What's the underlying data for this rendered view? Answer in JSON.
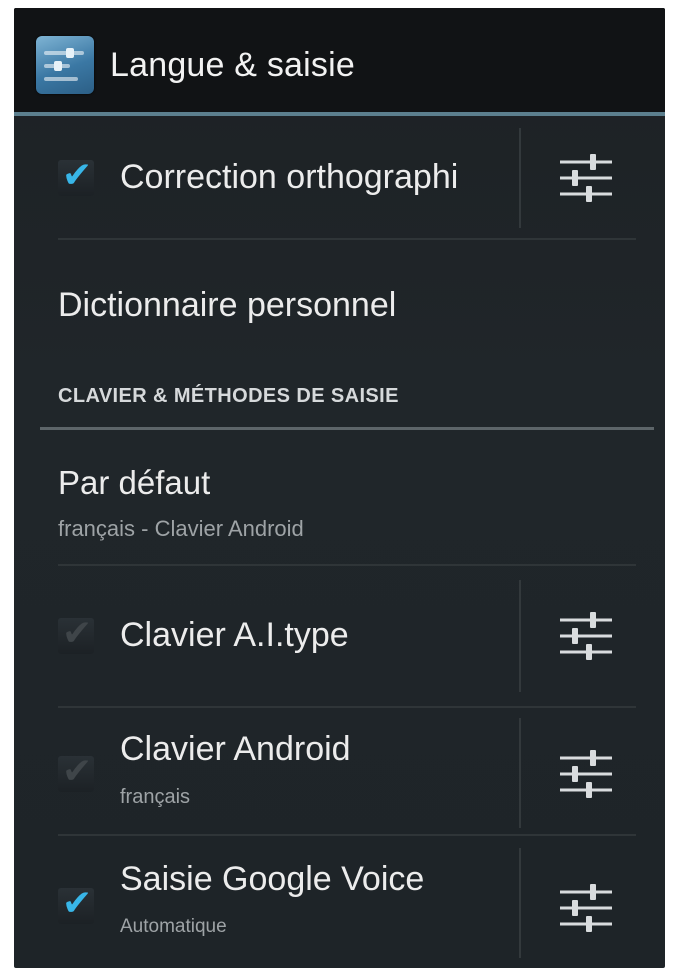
{
  "action_bar": {
    "title": "Langue & saisie",
    "icon": "language-settings-icon"
  },
  "items": [
    {
      "label": "Correction orthographi",
      "checked": true,
      "has_settings": true
    },
    {
      "label": "Dictionnaire personnel"
    },
    {
      "label": "Par défaut",
      "summary": "français - Clavier Android"
    },
    {
      "label": "Clavier A.I.type",
      "checked": false,
      "has_settings": true
    },
    {
      "label": "Clavier Android",
      "summary": "français",
      "checked": false,
      "has_settings": true
    },
    {
      "label": "Saisie Google Voice",
      "summary": "Automatique",
      "checked": true,
      "has_settings": true
    }
  ],
  "section": {
    "header": "CLAVIER & MÉTHODES DE SAISIE"
  },
  "icons": {
    "settings": "sliders-settings-icon",
    "check": "checkmark-icon"
  },
  "colors": {
    "accent": "#38b6e8",
    "background": "#1e2428",
    "action_bar": "#111315",
    "action_bar_underline": "#5c7f8e"
  }
}
